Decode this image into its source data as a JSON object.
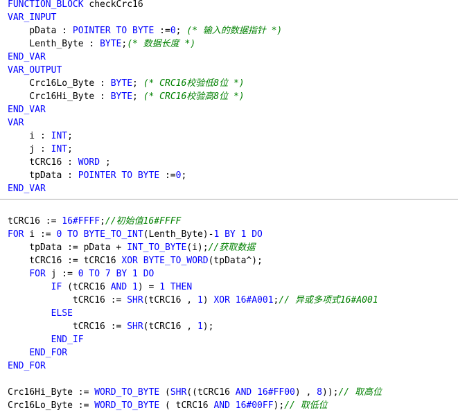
{
  "colors": {
    "keyword": "#0000ff",
    "comment": "#008000",
    "text": "#000000",
    "background": "#ffffff",
    "divider": "#a9a9a9"
  },
  "declaration": {
    "lines": [
      [
        {
          "t": "kw",
          "v": "FUNCTION_BLOCK"
        },
        {
          "t": "tx",
          "v": " checkCrc16"
        }
      ],
      [
        {
          "t": "kw",
          "v": "VAR_INPUT"
        }
      ],
      [
        {
          "t": "tx",
          "v": "    pData : "
        },
        {
          "t": "kw",
          "v": "POINTER TO BYTE"
        },
        {
          "t": "tx",
          "v": " :="
        },
        {
          "t": "num",
          "v": "0"
        },
        {
          "t": "tx",
          "v": "; "
        },
        {
          "t": "cm",
          "v": "(* 输入的数据指针 *)"
        }
      ],
      [
        {
          "t": "tx",
          "v": "    Lenth_Byte : "
        },
        {
          "t": "kw",
          "v": "BYTE"
        },
        {
          "t": "tx",
          "v": ";"
        },
        {
          "t": "cm",
          "v": "(* 数据长度 *)"
        }
      ],
      [
        {
          "t": "kw",
          "v": "END_VAR"
        }
      ],
      [
        {
          "t": "kw",
          "v": "VAR_OUTPUT"
        }
      ],
      [
        {
          "t": "tx",
          "v": "    Crc16Lo_Byte : "
        },
        {
          "t": "kw",
          "v": "BYTE"
        },
        {
          "t": "tx",
          "v": "; "
        },
        {
          "t": "cm",
          "v": "(* CRC16校验低8位 *)"
        }
      ],
      [
        {
          "t": "tx",
          "v": "    Crc16Hi_Byte : "
        },
        {
          "t": "kw",
          "v": "BYTE"
        },
        {
          "t": "tx",
          "v": "; "
        },
        {
          "t": "cm",
          "v": "(* CRC16校验高8位 *)"
        }
      ],
      [
        {
          "t": "kw",
          "v": "END_VAR"
        }
      ],
      [
        {
          "t": "kw",
          "v": "VAR"
        }
      ],
      [
        {
          "t": "tx",
          "v": "    i : "
        },
        {
          "t": "kw",
          "v": "INT"
        },
        {
          "t": "tx",
          "v": ";"
        }
      ],
      [
        {
          "t": "tx",
          "v": "    j : "
        },
        {
          "t": "kw",
          "v": "INT"
        },
        {
          "t": "tx",
          "v": ";"
        }
      ],
      [
        {
          "t": "tx",
          "v": "    tCRC16 : "
        },
        {
          "t": "kw",
          "v": "WORD"
        },
        {
          "t": "tx",
          "v": " ;"
        }
      ],
      [
        {
          "t": "tx",
          "v": "    tpData : "
        },
        {
          "t": "kw",
          "v": "POINTER TO BYTE"
        },
        {
          "t": "tx",
          "v": " :="
        },
        {
          "t": "num",
          "v": "0"
        },
        {
          "t": "tx",
          "v": ";"
        }
      ],
      [
        {
          "t": "kw",
          "v": "END_VAR"
        }
      ]
    ]
  },
  "implementation": {
    "lines": [
      [
        {
          "t": "tx",
          "v": "tCRC16 := "
        },
        {
          "t": "num",
          "v": "16#FFFF"
        },
        {
          "t": "tx",
          "v": ";"
        },
        {
          "t": "cm",
          "v": "//初始值16#FFFF"
        }
      ],
      [
        {
          "t": "kw",
          "v": "FOR"
        },
        {
          "t": "tx",
          "v": " i := "
        },
        {
          "t": "num",
          "v": "0"
        },
        {
          "t": "tx",
          "v": " "
        },
        {
          "t": "kw",
          "v": "TO"
        },
        {
          "t": "tx",
          "v": " "
        },
        {
          "t": "kw",
          "v": "BYTE_TO_INT"
        },
        {
          "t": "tx",
          "v": "(Lenth_Byte)-"
        },
        {
          "t": "num",
          "v": "1"
        },
        {
          "t": "tx",
          "v": " "
        },
        {
          "t": "kw",
          "v": "BY"
        },
        {
          "t": "tx",
          "v": " "
        },
        {
          "t": "num",
          "v": "1"
        },
        {
          "t": "tx",
          "v": " "
        },
        {
          "t": "kw",
          "v": "DO"
        }
      ],
      [
        {
          "t": "tx",
          "v": "    tpData := pData + "
        },
        {
          "t": "kw",
          "v": "INT_TO_BYTE"
        },
        {
          "t": "tx",
          "v": "(i);"
        },
        {
          "t": "cm",
          "v": "//获取数据"
        }
      ],
      [
        {
          "t": "tx",
          "v": "    tCRC16 := tCRC16 "
        },
        {
          "t": "kw",
          "v": "XOR"
        },
        {
          "t": "tx",
          "v": " "
        },
        {
          "t": "kw",
          "v": "BYTE_TO_WORD"
        },
        {
          "t": "tx",
          "v": "(tpData^);"
        }
      ],
      [
        {
          "t": "tx",
          "v": "    "
        },
        {
          "t": "kw",
          "v": "FOR"
        },
        {
          "t": "tx",
          "v": " j := "
        },
        {
          "t": "num",
          "v": "0"
        },
        {
          "t": "tx",
          "v": " "
        },
        {
          "t": "kw",
          "v": "TO"
        },
        {
          "t": "tx",
          "v": " "
        },
        {
          "t": "num",
          "v": "7"
        },
        {
          "t": "tx",
          "v": " "
        },
        {
          "t": "kw",
          "v": "BY"
        },
        {
          "t": "tx",
          "v": " "
        },
        {
          "t": "num",
          "v": "1"
        },
        {
          "t": "tx",
          "v": " "
        },
        {
          "t": "kw",
          "v": "DO"
        }
      ],
      [
        {
          "t": "tx",
          "v": "        "
        },
        {
          "t": "kw",
          "v": "IF"
        },
        {
          "t": "tx",
          "v": " (tCRC16 "
        },
        {
          "t": "kw",
          "v": "AND"
        },
        {
          "t": "tx",
          "v": " "
        },
        {
          "t": "num",
          "v": "1"
        },
        {
          "t": "tx",
          "v": ") = "
        },
        {
          "t": "num",
          "v": "1"
        },
        {
          "t": "tx",
          "v": " "
        },
        {
          "t": "kw",
          "v": "THEN"
        }
      ],
      [
        {
          "t": "tx",
          "v": "            tCRC16 := "
        },
        {
          "t": "kw",
          "v": "SHR"
        },
        {
          "t": "tx",
          "v": "(tCRC16 , "
        },
        {
          "t": "num",
          "v": "1"
        },
        {
          "t": "tx",
          "v": ") "
        },
        {
          "t": "kw",
          "v": "XOR"
        },
        {
          "t": "tx",
          "v": " "
        },
        {
          "t": "num",
          "v": "16#A001"
        },
        {
          "t": "tx",
          "v": ";"
        },
        {
          "t": "cm",
          "v": "// 异或多项式16#A001"
        }
      ],
      [
        {
          "t": "tx",
          "v": "        "
        },
        {
          "t": "kw",
          "v": "ELSE"
        }
      ],
      [
        {
          "t": "tx",
          "v": "            tCRC16 := "
        },
        {
          "t": "kw",
          "v": "SHR"
        },
        {
          "t": "tx",
          "v": "(tCRC16 , "
        },
        {
          "t": "num",
          "v": "1"
        },
        {
          "t": "tx",
          "v": ");"
        }
      ],
      [
        {
          "t": "tx",
          "v": "        "
        },
        {
          "t": "kw",
          "v": "END_IF"
        }
      ],
      [
        {
          "t": "tx",
          "v": "    "
        },
        {
          "t": "kw",
          "v": "END_FOR"
        }
      ],
      [
        {
          "t": "kw",
          "v": "END_FOR"
        }
      ],
      [
        {
          "t": "tx",
          "v": ""
        }
      ],
      [
        {
          "t": "tx",
          "v": "Crc16Hi_Byte := "
        },
        {
          "t": "kw",
          "v": "WORD_TO_BYTE"
        },
        {
          "t": "tx",
          "v": " ("
        },
        {
          "t": "kw",
          "v": "SHR"
        },
        {
          "t": "tx",
          "v": "((tCRC16 "
        },
        {
          "t": "kw",
          "v": "AND"
        },
        {
          "t": "tx",
          "v": " "
        },
        {
          "t": "num",
          "v": "16#FF00"
        },
        {
          "t": "tx",
          "v": ") , "
        },
        {
          "t": "num",
          "v": "8"
        },
        {
          "t": "tx",
          "v": "));"
        },
        {
          "t": "cm",
          "v": "// 取高位"
        }
      ],
      [
        {
          "t": "tx",
          "v": "Crc16Lo_Byte := "
        },
        {
          "t": "kw",
          "v": "WORD_TO_BYTE"
        },
        {
          "t": "tx",
          "v": " ( tCRC16 "
        },
        {
          "t": "kw",
          "v": "AND"
        },
        {
          "t": "tx",
          "v": " "
        },
        {
          "t": "num",
          "v": "16#00FF"
        },
        {
          "t": "tx",
          "v": ");"
        },
        {
          "t": "cm",
          "v": "// 取低位"
        }
      ]
    ]
  }
}
